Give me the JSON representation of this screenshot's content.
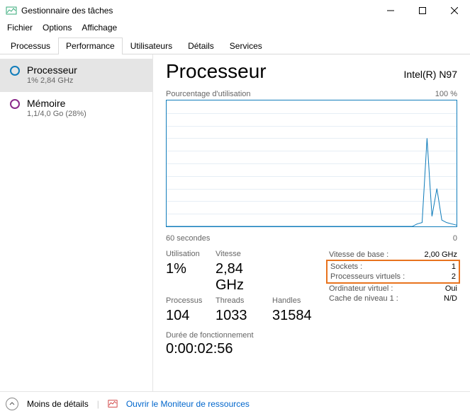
{
  "window": {
    "title": "Gestionnaire des tâches"
  },
  "menu": {
    "file": "Fichier",
    "options": "Options",
    "view": "Affichage"
  },
  "tabs": {
    "processes": "Processus",
    "performance": "Performance",
    "users": "Utilisateurs",
    "details": "Détails",
    "services": "Services"
  },
  "sidebar": {
    "cpu": {
      "name": "Processeur",
      "sub": "1% 2,84 GHz"
    },
    "mem": {
      "name": "Mémoire",
      "sub": "1,1/4,0 Go (28%)"
    }
  },
  "main": {
    "title": "Processeur",
    "model": "Intel(R) N97",
    "chart_top_left": "Pourcentage d'utilisation",
    "chart_top_right": "100 %",
    "chart_bottom_left": "60 secondes",
    "chart_bottom_right": "0"
  },
  "stats": {
    "util_label": "Utilisation",
    "util_value": "1%",
    "speed_label": "Vitesse",
    "speed_value": "2,84 GHz",
    "proc_label": "Processus",
    "proc_value": "104",
    "threads_label": "Threads",
    "threads_value": "1033",
    "handles_label": "Handles",
    "handles_value": "31584"
  },
  "right_stats": {
    "base_k": "Vitesse de base :",
    "base_v": "2,00 GHz",
    "sockets_k": "Sockets :",
    "sockets_v": "1",
    "vproc_k": "Processeurs virtuels :",
    "vproc_v": "2",
    "vm_k": "Ordinateur virtuel :",
    "vm_v": "Oui",
    "l1_k": "Cache de niveau 1 :",
    "l1_v": "N/D"
  },
  "uptime": {
    "label": "Durée de fonctionnement",
    "value": "0:00:02:56"
  },
  "footer": {
    "less_details": "Moins de détails",
    "open_monitor": "Ouvrir le Moniteur de ressources"
  },
  "chart_data": {
    "type": "line",
    "title": "Pourcentage d'utilisation",
    "xlabel": "60 secondes",
    "ylabel": "",
    "ylim": [
      0,
      100
    ],
    "xrange_seconds": 60,
    "values": [
      0,
      0,
      0,
      0,
      0,
      0,
      0,
      0,
      0,
      0,
      0,
      0,
      0,
      0,
      0,
      0,
      0,
      0,
      0,
      0,
      0,
      0,
      0,
      0,
      0,
      0,
      0,
      0,
      0,
      0,
      0,
      0,
      0,
      0,
      0,
      0,
      0,
      0,
      0,
      0,
      0,
      0,
      0,
      0,
      0,
      0,
      0,
      0,
      0,
      0,
      0,
      2,
      3,
      70,
      8,
      30,
      5,
      3,
      2,
      1
    ]
  }
}
